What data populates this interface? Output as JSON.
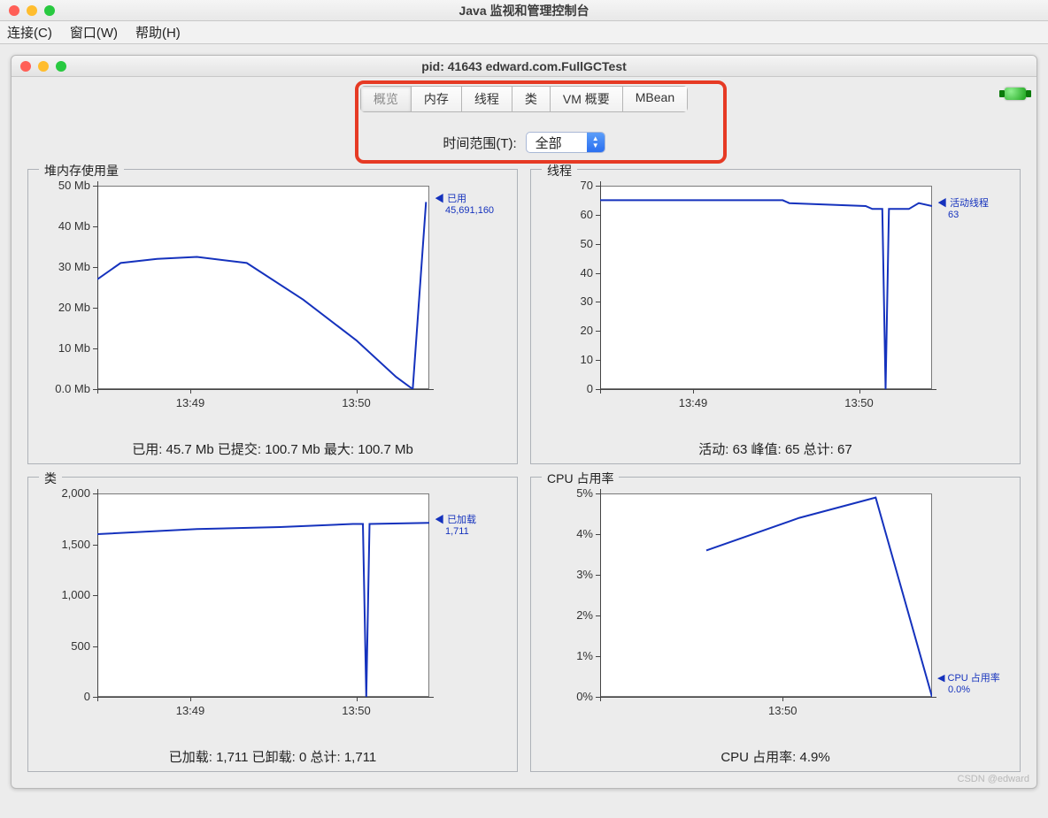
{
  "outer_title": "Java 监视和管理控制台",
  "menubar": {
    "connect": "连接(C)",
    "window": "窗口(W)",
    "help": "帮助(H)"
  },
  "inner_title": "pid: 41643 edward.com.FullGCTest",
  "tabs": {
    "overview": "概览",
    "memory": "内存",
    "threads": "线程",
    "classes": "类",
    "vm": "VM 概要",
    "mbean": "MBean",
    "selected": "overview"
  },
  "time_range": {
    "label": "时间范围(T):",
    "value": "全部"
  },
  "panels": {
    "heap": {
      "title": "堆内存使用量",
      "legend_name": "已用",
      "legend_value": "45,691,160",
      "summary": "已用: 45.7 Mb    已提交: 100.7 Mb    最大: 100.7 Mb"
    },
    "threads": {
      "title": "线程",
      "legend_name": "活动线程",
      "legend_value": "63",
      "summary": "活动: 63    峰值: 65    总计: 67"
    },
    "classes": {
      "title": "类",
      "legend_name": "已加载",
      "legend_value": "1,711",
      "summary": "已加载: 1,711    已卸载: 0    总计: 1,711"
    },
    "cpu": {
      "title": "CPU 占用率",
      "legend_name": "CPU 占用率",
      "legend_value": "0.0%",
      "summary": "CPU 占用率: 4.9%"
    }
  },
  "watermark": "CSDN @edward",
  "chart_data": [
    {
      "id": "heap",
      "type": "line",
      "title": "堆内存使用量",
      "ylabel": "Mb",
      "ylim": [
        0,
        50
      ],
      "y_ticks": [
        "0.0 Mb",
        "10 Mb",
        "20 Mb",
        "30 Mb",
        "40 Mb",
        "50 Mb"
      ],
      "x_ticks": [
        "13:49",
        "13:50"
      ],
      "series": [
        {
          "name": "已用",
          "values": [
            {
              "x": 0.0,
              "y": 27
            },
            {
              "x": 0.07,
              "y": 31
            },
            {
              "x": 0.18,
              "y": 32
            },
            {
              "x": 0.3,
              "y": 32.5
            },
            {
              "x": 0.45,
              "y": 31
            },
            {
              "x": 0.62,
              "y": 22
            },
            {
              "x": 0.78,
              "y": 12
            },
            {
              "x": 0.9,
              "y": 3
            },
            {
              "x": 0.95,
              "y": 0
            },
            {
              "x": 0.99,
              "y": 46
            }
          ]
        }
      ]
    },
    {
      "id": "threads",
      "type": "line",
      "title": "线程",
      "ylabel": "",
      "ylim": [
        0,
        70
      ],
      "y_ticks": [
        "0",
        "10",
        "20",
        "30",
        "40",
        "50",
        "60",
        "70"
      ],
      "x_ticks": [
        "13:49",
        "13:50"
      ],
      "series": [
        {
          "name": "活动线程",
          "values": [
            {
              "x": 0.0,
              "y": 65
            },
            {
              "x": 0.55,
              "y": 65
            },
            {
              "x": 0.57,
              "y": 64
            },
            {
              "x": 0.8,
              "y": 63
            },
            {
              "x": 0.82,
              "y": 62
            },
            {
              "x": 0.85,
              "y": 62
            },
            {
              "x": 0.86,
              "y": 0
            },
            {
              "x": 0.87,
              "y": 62
            },
            {
              "x": 0.93,
              "y": 62
            },
            {
              "x": 0.96,
              "y": 64
            },
            {
              "x": 1.0,
              "y": 63
            }
          ]
        }
      ]
    },
    {
      "id": "classes",
      "type": "line",
      "title": "类",
      "ylabel": "",
      "ylim": [
        0,
        2000
      ],
      "y_ticks": [
        "0",
        "500",
        "1,000",
        "1,500",
        "2,000"
      ],
      "x_ticks": [
        "13:49",
        "13:50"
      ],
      "series": [
        {
          "name": "已加载",
          "values": [
            {
              "x": 0.0,
              "y": 1600
            },
            {
              "x": 0.3,
              "y": 1650
            },
            {
              "x": 0.55,
              "y": 1670
            },
            {
              "x": 0.77,
              "y": 1700
            },
            {
              "x": 0.8,
              "y": 1700
            },
            {
              "x": 0.81,
              "y": 0
            },
            {
              "x": 0.82,
              "y": 1700
            },
            {
              "x": 1.0,
              "y": 1711
            }
          ]
        }
      ]
    },
    {
      "id": "cpu",
      "type": "line",
      "title": "CPU 占用率",
      "ylabel": "%",
      "ylim": [
        0,
        5
      ],
      "y_ticks": [
        "0%",
        "1%",
        "2%",
        "3%",
        "4%",
        "5%"
      ],
      "x_ticks": [
        "13:50"
      ],
      "series": [
        {
          "name": "CPU 占用率",
          "values": [
            {
              "x": 0.32,
              "y": 3.6
            },
            {
              "x": 0.6,
              "y": 4.4
            },
            {
              "x": 0.83,
              "y": 4.9
            },
            {
              "x": 1.0,
              "y": 0.0
            }
          ]
        }
      ]
    }
  ]
}
